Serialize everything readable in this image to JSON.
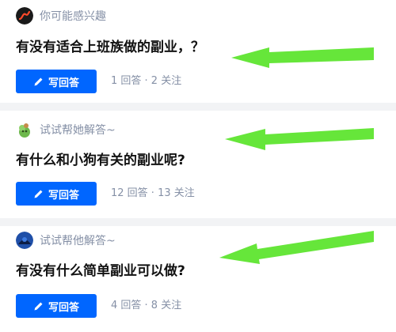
{
  "colors": {
    "accent": "#0066ff",
    "arrow": "#66e63a",
    "muted_text": "#8590a6",
    "title_text": "#121212",
    "background": "#f2f3f5"
  },
  "cards": [
    {
      "avatar_icon": "brand-logo-icon",
      "source_label": "你可能感兴趣",
      "question": "有没有适合上班族做的副业，？",
      "answer_label": "写回答",
      "stats": "1 回答 · 2 关注"
    },
    {
      "avatar_icon": "green-character-avatar",
      "source_label": "试试帮她解答~",
      "question": "有什么和小狗有关的副业呢?",
      "answer_label": "写回答",
      "stats": "12 回答 · 13 关注"
    },
    {
      "avatar_icon": "blue-character-avatar",
      "source_label": "试试帮他解答~",
      "question": "有没有什么简单副业可以做?",
      "answer_label": "写回答",
      "stats": "4 回答 · 8 关注"
    }
  ]
}
